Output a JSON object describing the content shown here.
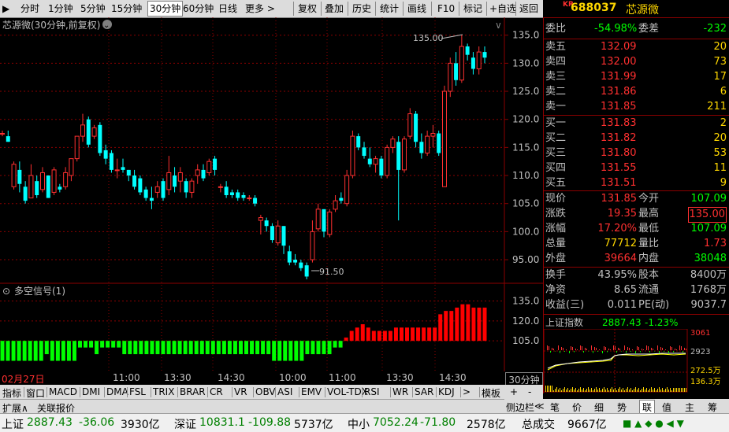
{
  "toolbar": {
    "periods": [
      "分时",
      "1分钟",
      "5分钟",
      "15分钟",
      "30分钟",
      "60分钟",
      "日线",
      "更多 >"
    ],
    "active_period": "30分钟",
    "tools": [
      "复权",
      "叠加",
      "历史",
      "统计",
      "画线",
      "F10",
      "标记",
      "+自选",
      "返回"
    ]
  },
  "stock": {
    "market": "KR",
    "code": "688037",
    "name": "芯源微"
  },
  "chart": {
    "title": "芯源微(30分钟,前复权)",
    "high_label": "135.00",
    "low_label": "91.50",
    "y_ticks": [
      "135.0",
      "130.0",
      "125.0",
      "120.0",
      "115.0",
      "110.0",
      "105.0",
      "100.0",
      "95.00"
    ],
    "indicator_title": "多空信号(1)",
    "indicator_ticks": [
      "135.0",
      "120.0",
      "105.0"
    ],
    "x_labels": [
      "02月27日",
      "11:00",
      "13:30",
      "14:30",
      "10:00",
      "11:00",
      "13:30",
      "14:30"
    ],
    "period_label": "30分钟",
    "colors": {
      "up": "#ff3030",
      "down": "#00ffff",
      "bull": "#ff0000",
      "bear": "#00ff00",
      "grid": "#8b0000"
    }
  },
  "chart_data": {
    "type": "candlestick",
    "ylim": [
      91.5,
      136.5
    ],
    "candles": [
      [
        117.5,
        117.5,
        118,
        117
      ],
      [
        117,
        116,
        118,
        116
      ],
      [
        108,
        112,
        112.5,
        107.5
      ],
      [
        111,
        108.5,
        112.5,
        107
      ],
      [
        108,
        105.5,
        109,
        105
      ],
      [
        106,
        110,
        112,
        106
      ],
      [
        109,
        106.5,
        110,
        106
      ],
      [
        107.5,
        110.5,
        111.5,
        107
      ],
      [
        110,
        106,
        110,
        106
      ],
      [
        107,
        111,
        111.5,
        106.5
      ],
      [
        108,
        107.5,
        108.5,
        107
      ],
      [
        108,
        110.5,
        111.5,
        107.5
      ],
      [
        110,
        113,
        113,
        109
      ],
      [
        113,
        117,
        117,
        112.5
      ],
      [
        117,
        119,
        121,
        116
      ],
      [
        120,
        115.5,
        120.5,
        115
      ],
      [
        117,
        118.5,
        119,
        116.5
      ],
      [
        119,
        114,
        119.5,
        113.5
      ],
      [
        114.5,
        113,
        115.5,
        112
      ],
      [
        114,
        111,
        114.5,
        110.5
      ],
      [
        111,
        111,
        113,
        109.5
      ],
      [
        111.5,
        111,
        113,
        110.5
      ],
      [
        111,
        110,
        111,
        109
      ],
      [
        110,
        108,
        111,
        107.5
      ],
      [
        109.5,
        107,
        110,
        106.5
      ],
      [
        107.5,
        106,
        108,
        105.5
      ],
      [
        106,
        105.5,
        108,
        104
      ],
      [
        107,
        108,
        109,
        106
      ],
      [
        109,
        106,
        109.5,
        105.5
      ],
      [
        107.5,
        110.5,
        113.5,
        106.5
      ],
      [
        110,
        108,
        111.5,
        107
      ],
      [
        109,
        110.5,
        111.5,
        107
      ],
      [
        109,
        107,
        109.5,
        106
      ],
      [
        107,
        109,
        109.5,
        106
      ],
      [
        110,
        111,
        112,
        108.5
      ],
      [
        111,
        109.5,
        112,
        109
      ],
      [
        110.5,
        112.5,
        113,
        110
      ],
      [
        113,
        111,
        113.5,
        110
      ],
      [
        108,
        108,
        108.5,
        107
      ],
      [
        108,
        106.5,
        109,
        106
      ],
      [
        107,
        106.5,
        107.5,
        106
      ],
      [
        107,
        106,
        107.5,
        105.5
      ],
      [
        106.5,
        106,
        107,
        105.5
      ],
      [
        106,
        106,
        106.5,
        105.5
      ],
      [
        106,
        105,
        106.5,
        104.5
      ],
      [
        102,
        102.5,
        103,
        99.5
      ],
      [
        102,
        101,
        102.5,
        100
      ],
      [
        101,
        98.5,
        101.5,
        98
      ],
      [
        98,
        101,
        102,
        97.5
      ],
      [
        101,
        97.5,
        101,
        96
      ],
      [
        96.5,
        94.5,
        97.5,
        94
      ],
      [
        95,
        94.5,
        96,
        94
      ],
      [
        94.5,
        93.5,
        95,
        93
      ],
      [
        94,
        92,
        94.5,
        91.5
      ],
      [
        95,
        100,
        102,
        94.5
      ],
      [
        100.5,
        104,
        105,
        100
      ],
      [
        104,
        100,
        104,
        99
      ],
      [
        99.5,
        103.5,
        104,
        99
      ],
      [
        104,
        105.5,
        106.5,
        103.5
      ],
      [
        106,
        105.5,
        107,
        105
      ],
      [
        105,
        110,
        111,
        104.5
      ],
      [
        110,
        117,
        118,
        109.5
      ],
      [
        117,
        115,
        117.5,
        114.5
      ],
      [
        115,
        113.5,
        116,
        113
      ],
      [
        113,
        112,
        115,
        111.5
      ],
      [
        112,
        113,
        113.5,
        110.5
      ],
      [
        113,
        110,
        113.5,
        109.5
      ],
      [
        110,
        115,
        115.5,
        109.5
      ],
      [
        115,
        116.5,
        117,
        114
      ],
      [
        116,
        111,
        117,
        102
      ],
      [
        111,
        116.5,
        117,
        110.5
      ],
      [
        117,
        121,
        122,
        116.5
      ],
      [
        121,
        116,
        121.5,
        115
      ],
      [
        116,
        114,
        117.5,
        113
      ],
      [
        114,
        117,
        118,
        113.5
      ],
      [
        117,
        117.5,
        119,
        115
      ],
      [
        117.5,
        114,
        118,
        113.5
      ],
      [
        108,
        125,
        126,
        108
      ],
      [
        125,
        130,
        131,
        124
      ],
      [
        130,
        127,
        132,
        126
      ],
      [
        127,
        133,
        135,
        126.5
      ],
      [
        133,
        131.5,
        133.5,
        130.5
      ],
      [
        131,
        129,
        132,
        128
      ],
      [
        129,
        132,
        133,
        128
      ],
      [
        132,
        131,
        133,
        130
      ]
    ],
    "signal": [
      -3,
      -3,
      -3,
      -3,
      -3,
      -3,
      -3,
      -3,
      -2,
      -3,
      -3,
      -3,
      -3,
      -3,
      -1,
      -1,
      -1,
      -2,
      -1,
      -1,
      -1,
      -1,
      -2,
      -2,
      -2,
      -2,
      -2,
      -2,
      -2,
      -2,
      -2,
      -2,
      -2,
      -2,
      -2,
      -2,
      -2,
      -2,
      -2,
      -2,
      -2,
      -2,
      -2,
      -2,
      -2,
      -2,
      -2,
      -2,
      -2,
      -3,
      -3,
      -3,
      -3,
      -3,
      -3,
      -2,
      -2,
      -2,
      -2,
      -2,
      -1,
      -1,
      0.5,
      1.5,
      2,
      2.5,
      2,
      1.5,
      1.5,
      1.5,
      1.5,
      2,
      2,
      2,
      2,
      2,
      2,
      2,
      2,
      4,
      4.5,
      4.5,
      5,
      5.5,
      5.5,
      5,
      5,
      5
    ],
    "signal_ylim": [
      -4,
      7
    ]
  },
  "quote": {
    "weibi_label": "委比",
    "weibi": "-54.98%",
    "weicha_label": "委差",
    "weicha": "-232",
    "asks": [
      {
        "label": "卖五",
        "price": "132.09",
        "vol": "20"
      },
      {
        "label": "卖四",
        "price": "132.00",
        "vol": "73"
      },
      {
        "label": "卖三",
        "price": "131.99",
        "vol": "17"
      },
      {
        "label": "卖二",
        "price": "131.86",
        "vol": "6"
      },
      {
        "label": "卖一",
        "price": "131.85",
        "vol": "211"
      }
    ],
    "bids": [
      {
        "label": "买一",
        "price": "131.83",
        "vol": "2"
      },
      {
        "label": "买二",
        "price": "131.82",
        "vol": "20"
      },
      {
        "label": "买三",
        "price": "131.80",
        "vol": "53"
      },
      {
        "label": "买四",
        "price": "131.55",
        "vol": "11"
      },
      {
        "label": "买五",
        "price": "131.51",
        "vol": "9"
      }
    ],
    "stats": [
      {
        "l1": "现价",
        "v1": "131.85",
        "l2": "今开",
        "v2": "107.09"
      },
      {
        "l1": "涨跌",
        "v1": "19.35",
        "l2": "最高",
        "v2": "135.00"
      },
      {
        "l1": "涨幅",
        "v1": "17.20%",
        "l2": "最低",
        "v2": "107.09"
      },
      {
        "l1": "总量",
        "v1": "77712",
        "l2": "量比",
        "v2": "1.73"
      },
      {
        "l1": "外盘",
        "v1": "39664",
        "l2": "内盘",
        "v2": "38048"
      }
    ],
    "stats2": [
      {
        "l1": "换手",
        "v1": "43.95%",
        "l2": "股本",
        "v2": "8400万"
      },
      {
        "l1": "净资",
        "v1": "8.65",
        "l2": "流通",
        "v2": "1768万"
      },
      {
        "l1": "收益(三)",
        "v1": "0.011",
        "l2": "PE(动)",
        "v2": "9037.7"
      }
    ]
  },
  "mini": {
    "title": "上证指数",
    "value": "2887.43",
    "change": "-1.23%",
    "ticks": [
      "3061",
      "2923",
      "272.5万",
      "136.3万"
    ]
  },
  "indicator_tabs": [
    "指标",
    "窗口",
    "MACD",
    "DMI",
    "DMA",
    "FSL",
    "TRIX",
    "BRAR",
    "CR",
    "VR",
    "OBV",
    "ASI",
    "EMV",
    "VOL-TDX",
    "RSI",
    "WR",
    "SAR",
    "KDJ",
    ">",
    "模板"
  ],
  "expand_bar": [
    "扩展∧",
    "关联报价"
  ],
  "side_tabs": [
    "侧边栏",
    "≪",
    "笔",
    "价",
    "细",
    "势",
    "联",
    "值",
    "主",
    "筹"
  ],
  "status": {
    "sh_label": "上证",
    "sh_val": "2887.43",
    "sh_chg": "-36.06",
    "sh_amt": "3930亿",
    "sz_label": "深证",
    "sz_val": "10831.1",
    "sz_chg": "-109.88",
    "sz_amt": "5737亿",
    "zx_label": "中小",
    "zx_val": "7052.24",
    "zx_chg": "-71.80",
    "zx_amt": "2578亿",
    "total_label": "总成交",
    "total_amt": "9667亿"
  }
}
